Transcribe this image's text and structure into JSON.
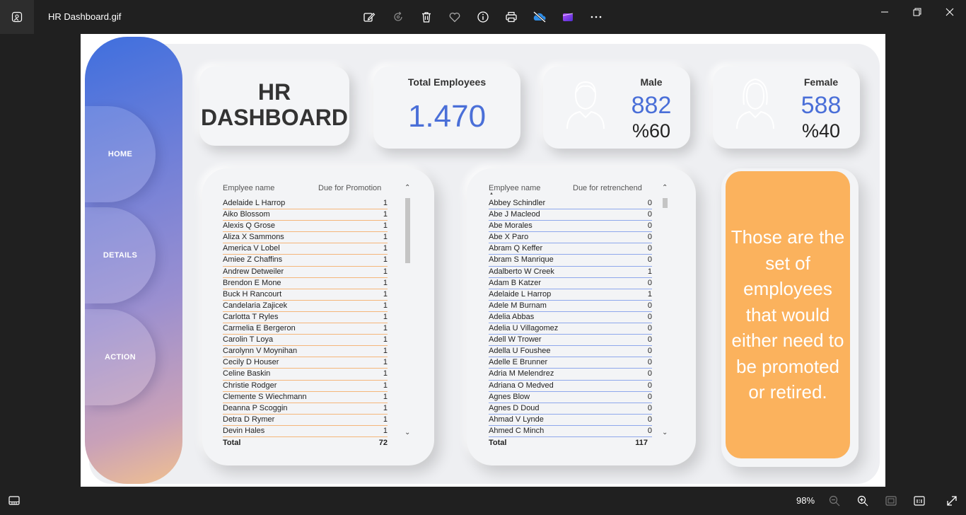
{
  "viewer": {
    "title": "HR Dashboard.gif",
    "zoom": "98%",
    "toolbar_icons": [
      "edit-icon",
      "rotate-icon",
      "delete-icon",
      "favorite-icon",
      "info-icon",
      "print-icon",
      "onedrive-icon",
      "clipchamp-icon",
      "more-icon"
    ]
  },
  "dashboard": {
    "title_line1": "HR",
    "title_line2": "DASHBOARD",
    "nav": [
      "HOME",
      "DETAILS",
      "ACTION"
    ],
    "total_employees": {
      "label": "Total Employees",
      "value": "1.470"
    },
    "male": {
      "label": "Male",
      "count": "882",
      "percent": "%60"
    },
    "female": {
      "label": "Female",
      "count": "588",
      "percent": "%40"
    },
    "promotion_table": {
      "col_name": "Emplyee name",
      "col_value": "Due for Promotion",
      "rows": [
        {
          "name": "Adelaide L Harrop",
          "value": "1"
        },
        {
          "name": "Aiko Blossom",
          "value": "1"
        },
        {
          "name": "Alexis Q Grose",
          "value": "1"
        },
        {
          "name": "Aliza X Sammons",
          "value": "1"
        },
        {
          "name": "America V Lobel",
          "value": "1"
        },
        {
          "name": "Amiee Z Chaffins",
          "value": "1"
        },
        {
          "name": "Andrew Detweiler",
          "value": "1"
        },
        {
          "name": "Brendon E Mone",
          "value": "1"
        },
        {
          "name": "Buck H Rancourt",
          "value": "1"
        },
        {
          "name": "Candelaria Zajicek",
          "value": "1"
        },
        {
          "name": "Carlotta T Ryles",
          "value": "1"
        },
        {
          "name": "Carmelia E Bergeron",
          "value": "1"
        },
        {
          "name": "Carolin T Loya",
          "value": "1"
        },
        {
          "name": "Carolynn V Moynihan",
          "value": "1"
        },
        {
          "name": "Cecily D Houser",
          "value": "1"
        },
        {
          "name": "Celine Baskin",
          "value": "1"
        },
        {
          "name": "Christie Rodger",
          "value": "1"
        },
        {
          "name": "Clemente S Wiechmann",
          "value": "1"
        },
        {
          "name": "Deanna P Scoggin",
          "value": "1"
        },
        {
          "name": "Detra D Rymer",
          "value": "1"
        },
        {
          "name": "Devin Hales",
          "value": "1"
        }
      ],
      "total_label": "Total",
      "total_value": "72"
    },
    "retrench_table": {
      "col_name": "Emplyee name",
      "col_value": "Due for retrenchend",
      "rows": [
        {
          "name": "Abbey Schindler",
          "value": "0"
        },
        {
          "name": "Abe J Macleod",
          "value": "0"
        },
        {
          "name": "Abe Morales",
          "value": "0"
        },
        {
          "name": "Abe X Paro",
          "value": "0"
        },
        {
          "name": "Abram Q Keffer",
          "value": "0"
        },
        {
          "name": "Abram S Manrique",
          "value": "0"
        },
        {
          "name": "Adalberto W Creek",
          "value": "1"
        },
        {
          "name": "Adam B Katzer",
          "value": "0"
        },
        {
          "name": "Adelaide L Harrop",
          "value": "1"
        },
        {
          "name": "Adele M Burnam",
          "value": "0"
        },
        {
          "name": "Adelia Abbas",
          "value": "0"
        },
        {
          "name": "Adelia U Villagomez",
          "value": "0"
        },
        {
          "name": "Adell W Trower",
          "value": "0"
        },
        {
          "name": "Adella U Foushee",
          "value": "0"
        },
        {
          "name": "Adelle E Brunner",
          "value": "0"
        },
        {
          "name": "Adria M Melendrez",
          "value": "0"
        },
        {
          "name": "Adriana O Medved",
          "value": "0"
        },
        {
          "name": "Agnes Blow",
          "value": "0"
        },
        {
          "name": "Agnes D Doud",
          "value": "0"
        },
        {
          "name": "Ahmad V Lynde",
          "value": "0"
        },
        {
          "name": "Ahmed C Minch",
          "value": "0"
        }
      ],
      "total_label": "Total",
      "total_value": "117"
    },
    "note": "Those are the set of employees that would either need to be promoted or retired.",
    "colors": {
      "accent_blue": "#4a6fd8",
      "note_orange": "#fbb25d",
      "promo_line": "#f5b67a",
      "retrench_line": "#8fa8ec"
    }
  }
}
